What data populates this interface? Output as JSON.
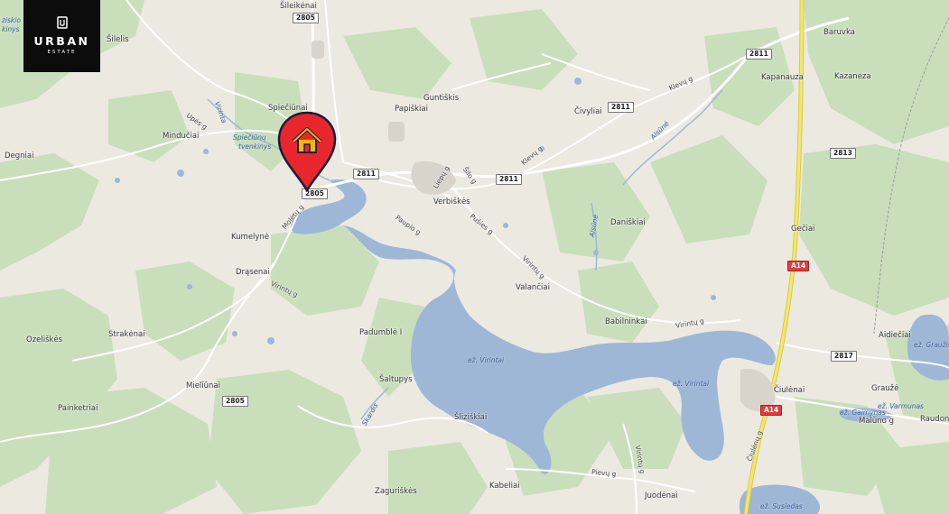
{
  "logo": {
    "brand": "URBAN",
    "sub": "ESTATE",
    "icon": "urban-estate-emblem"
  },
  "pin": {
    "icon": "home-marker-icon",
    "color": "#e8262e",
    "house_color": "#f7b500"
  },
  "colors": {
    "land": "#ece9e1",
    "forest": "#c9dfbc",
    "water": "#9fb7d6",
    "highway": "#f2e86b"
  },
  "places": {
    "sileikenai": "Šileikėnai",
    "silelis": "Šilelis",
    "spieciunai": "Spiečiūnai",
    "papiskiai": "Papiškiai",
    "guntiskis": "Guntiškis",
    "civyliai": "Čivyliai",
    "baruvka": "Baruvka",
    "kapanauza": "Kapanauza",
    "kazaneza": "Kazaneza",
    "mindučiai": "Mindučiai",
    "degniai": "Degniai",
    "verbiskes": "Verbiškės",
    "daniskiai": "Daniškiai",
    "geciai": "Gečiai",
    "kumelyne": "Kumelynė",
    "drasenai": "Drąsenai",
    "valanciai": "Valančiai",
    "babilninkai": "Babilninkai",
    "aidieciai": "Aidiečiai",
    "ozeliskes": "Ozeliškės",
    "strakenai": "Strakėnai",
    "padumble": "Padumblė I",
    "saltupys": "Šaltupys",
    "ciulenai": "Čiulėnai",
    "grauze": "Graužė",
    "raudone": "Raudonė",
    "mielīunai": "Mielīūnai",
    "painketriai": "Painketriai",
    "sliziskiai": "Šliziškiai",
    "maluno": "Malūno g",
    "zaguriskes": "Zaguriškės",
    "kabeliai": "Kabeliai",
    "juodenai": "Juodėnai",
    "siskio_top": "ziskio",
    "siskio_bottom": "kinys"
  },
  "waters": {
    "spieciunu": "Spiečiūnų",
    "tvenkinys": "tvenkinys",
    "virinta_river": "Virinta",
    "alsune": "Alsūnė",
    "alsune2": "Alsūnė",
    "ez_virintai1": "ež. Virintai",
    "ez_virintai2": "ež. Virintai",
    "ez_grauzis": "ež. Graužis",
    "ez_varmunas": "ež. Varmunas",
    "ez_gaimynas": "ež. Gaimynas",
    "ez_susiedas": "ež. Susiedas",
    "skardis": "Skardis"
  },
  "streets": {
    "upes": "Upės g",
    "moletu": "Molėtų g",
    "liepu": "Liepų g",
    "silo": "Šilo g",
    "kleviu1": "Klevų g",
    "kleviu2": "Klevų g",
    "paupio": "Paupio g",
    "pusies": "Pušies g",
    "virintu1": "Virintų g",
    "virintu2": "Virintų g",
    "virintu3": "Virintų g",
    "virintu4": "Virintų g",
    "pievu": "Pievų g",
    "ciuleniu": "Čiulėnų g",
    "vilniaus": "Vilniaus g"
  },
  "shields": {
    "s2805a": "2805",
    "s2805b": "2805",
    "s2805c": "2805",
    "s2811a": "2811",
    "s2811b": "2811",
    "s2811c": "2811",
    "s2811d": "2811",
    "s2813": "2813",
    "s2817": "2817",
    "a14a": "A14",
    "a14b": "A14"
  }
}
